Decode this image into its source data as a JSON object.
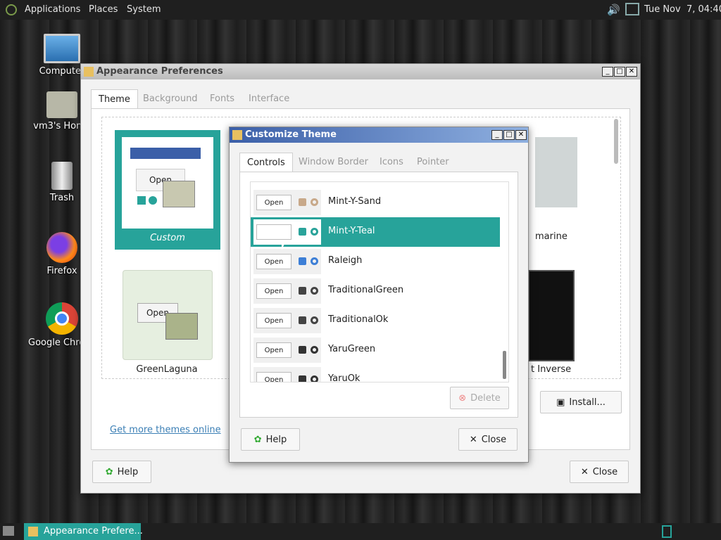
{
  "top_panel": {
    "menus": [
      "Applications",
      "Places",
      "System"
    ],
    "clock": "Tue Nov  7, 04:40"
  },
  "desktop_icons": [
    {
      "label": "Computer",
      "icon": "computer-icon"
    },
    {
      "label": "vm3's Home",
      "icon": "home-folder-icon"
    },
    {
      "label": "Trash",
      "icon": "trash-icon"
    },
    {
      "label": "Firefox",
      "icon": "firefox-icon"
    },
    {
      "label": "Google Chrome",
      "icon": "chrome-icon"
    }
  ],
  "appearance": {
    "title": "Appearance Preferences",
    "tabs": [
      "Theme",
      "Background",
      "Fonts",
      "Interface"
    ],
    "active_tab": "Theme",
    "themes": [
      {
        "name": "Custom",
        "selected": true
      },
      {
        "name": "GreenLaguna"
      },
      {
        "name": "marine"
      },
      {
        "name": "t Inverse"
      }
    ],
    "preview_open_label": "Open",
    "more_themes_link": "Get more themes online",
    "install_label": "Install...",
    "help_label": "Help",
    "close_label": "Close"
  },
  "customize": {
    "title": "Customize Theme",
    "tabs": [
      "Controls",
      "Window Border",
      "Icons",
      "Pointer"
    ],
    "active_tab": "Controls",
    "preview_open_label": "Open",
    "items": [
      {
        "name": "Mint-Y-Sand",
        "accent": "#c8a98a"
      },
      {
        "name": "Mint-Y-Teal",
        "accent": "#2aa39a",
        "selected": true
      },
      {
        "name": "Raleigh",
        "accent": "#3d7fd6"
      },
      {
        "name": "TraditionalGreen",
        "accent": "#444444"
      },
      {
        "name": "TraditionalOk",
        "accent": "#444444"
      },
      {
        "name": "YaruGreen",
        "accent": "#333333"
      },
      {
        "name": "YaruOk",
        "accent": "#333333"
      }
    ],
    "delete_label": "Delete",
    "help_label": "Help",
    "close_label": "Close"
  },
  "taskbar": {
    "window_label": "Appearance Prefere..."
  },
  "colors": {
    "accent": "#27a39a",
    "titlebar_active": "#3b5fa8"
  }
}
